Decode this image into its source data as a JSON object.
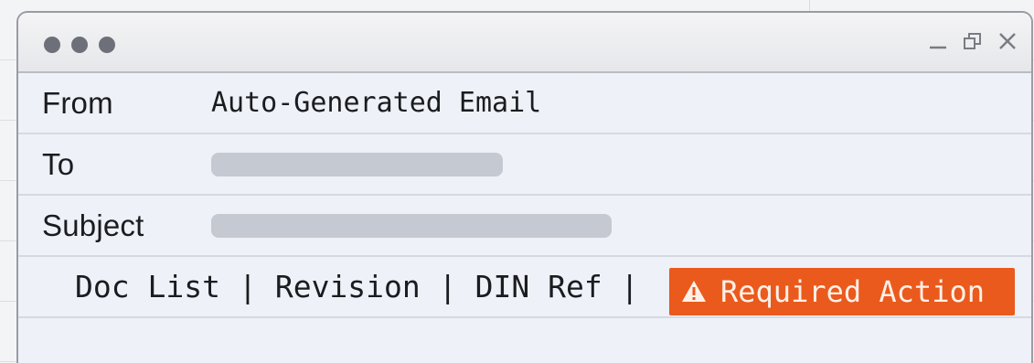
{
  "window": {
    "controls": {
      "minimize_icon": "minimize-icon",
      "restore_icon": "restore-icon",
      "close_icon": "close-icon"
    }
  },
  "email": {
    "from_label": "From",
    "from_value": "Auto-Generated Email",
    "to_label": "To",
    "subject_label": "Subject"
  },
  "tags": {
    "items": [
      "Doc List",
      "Revision",
      "DIN Ref"
    ],
    "separator": "|",
    "required_action": "Required Action",
    "required_icon": "warning-icon"
  },
  "colors": {
    "required_bg": "#ea5a1d",
    "redacted_fill": "#c5c9d1"
  }
}
